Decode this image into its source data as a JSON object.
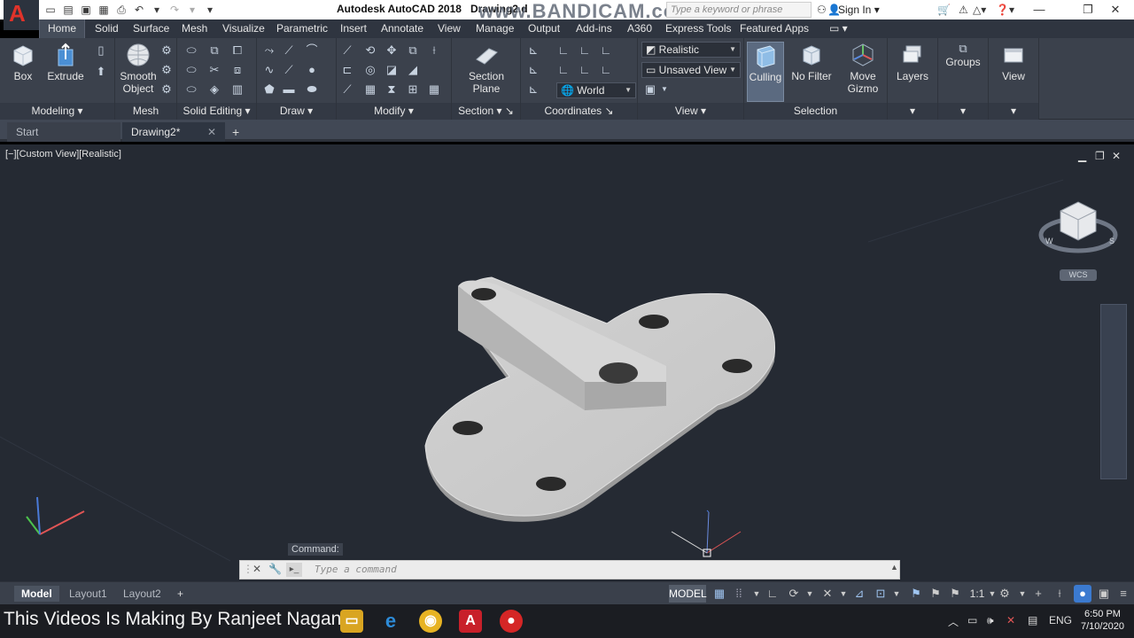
{
  "titlebar": {
    "title": "Autodesk AutoCAD 2018",
    "doc_title_fragment": "Drawing2.d",
    "watermark": "www.BANDICAM.com",
    "search_placeholder": "Type a keyword or phrase",
    "sign_in": "Sign In",
    "app_logo": "A"
  },
  "ribbon_tabs": [
    "Home",
    "Solid",
    "Surface",
    "Mesh",
    "Visualize",
    "Parametric",
    "Insert",
    "Annotate",
    "View",
    "Manage",
    "Output",
    "Add-ins",
    "A360",
    "Express Tools",
    "Featured Apps"
  ],
  "ribbon": {
    "modeling": {
      "title": "Modeling",
      "box": "Box",
      "extrude": "Extrude"
    },
    "mesh": {
      "title": "Mesh",
      "smooth_object": "Smooth Object"
    },
    "solid_editing": {
      "title": "Solid Editing"
    },
    "draw": {
      "title": "Draw"
    },
    "modify": {
      "title": "Modify"
    },
    "section": {
      "title": "Section",
      "section_plane": "Section Plane"
    },
    "coordinates": {
      "title": "Coordinates",
      "ucs_value": "World"
    },
    "view": {
      "title": "View",
      "visual_style": "Realistic",
      "named_view": "Unsaved View"
    },
    "selection": {
      "title": "Selection",
      "culling": "Culling",
      "no_filter": "No Filter",
      "move_gizmo": "Move Gizmo"
    },
    "layers": {
      "label": "Layers"
    },
    "groups": {
      "label": "Groups"
    },
    "view_big": {
      "label": "View"
    }
  },
  "file_tabs": {
    "start": "Start",
    "current": "Drawing2*"
  },
  "viewport": {
    "label": "[−][Custom View][Realistic]",
    "viewcube_wcs": "WCS",
    "command_history": "Command:",
    "command_placeholder": "Type a command"
  },
  "layout_tabs": [
    "Model",
    "Layout1",
    "Layout2"
  ],
  "statusbar": {
    "model": "MODEL",
    "scale": "1:1"
  },
  "taskbar": {
    "caption": "This Videos Is Making By Ranjeet Nagane",
    "lang": "ENG",
    "time": "6:50 PM",
    "date": "7/10/2020"
  }
}
